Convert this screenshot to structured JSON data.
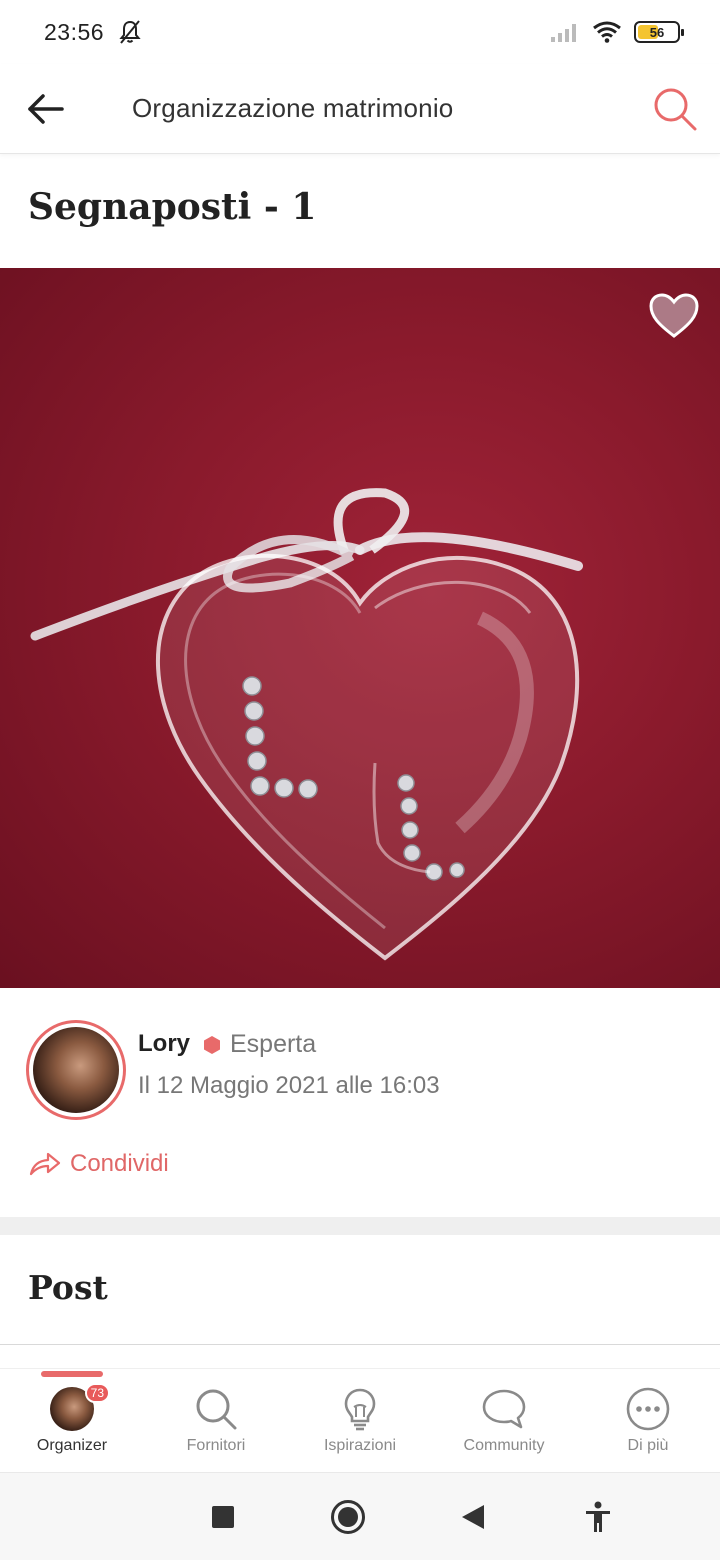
{
  "status_bar": {
    "time": "23:56",
    "battery_level": "56",
    "battery_fraction": 0.56,
    "icons": [
      "bell-muted-icon",
      "signal-icon",
      "wifi-icon",
      "battery-icon"
    ]
  },
  "app_bar": {
    "title": "Organizzazione matrimonio",
    "back_icon": "arrow-left-icon",
    "search_icon": "search-icon"
  },
  "page": {
    "title": "Segnaposti - 1"
  },
  "photo": {
    "favorite_icon": "heart-icon"
  },
  "author": {
    "name": "Lory",
    "rank": "Esperta",
    "date": "Il 12 Maggio 2021 alle 16:03"
  },
  "share": {
    "label": "Condividi",
    "icon": "share-arrow-icon"
  },
  "post_section": {
    "heading": "Post"
  },
  "bottom_nav": {
    "items": [
      {
        "label": "Organizer",
        "badge": "73",
        "active": true
      },
      {
        "label": "Fornitori",
        "icon": "search-icon"
      },
      {
        "label": "Ispirazioni",
        "icon": "lightbulb-icon"
      },
      {
        "label": "Community",
        "icon": "chat-bubble-icon"
      },
      {
        "label": "Di più",
        "icon": "more-dots-icon"
      }
    ]
  },
  "colors": {
    "accent": "#e86a6a",
    "hero_background": "#8a1a2c",
    "nav_inactive": "#8a8a8a"
  }
}
